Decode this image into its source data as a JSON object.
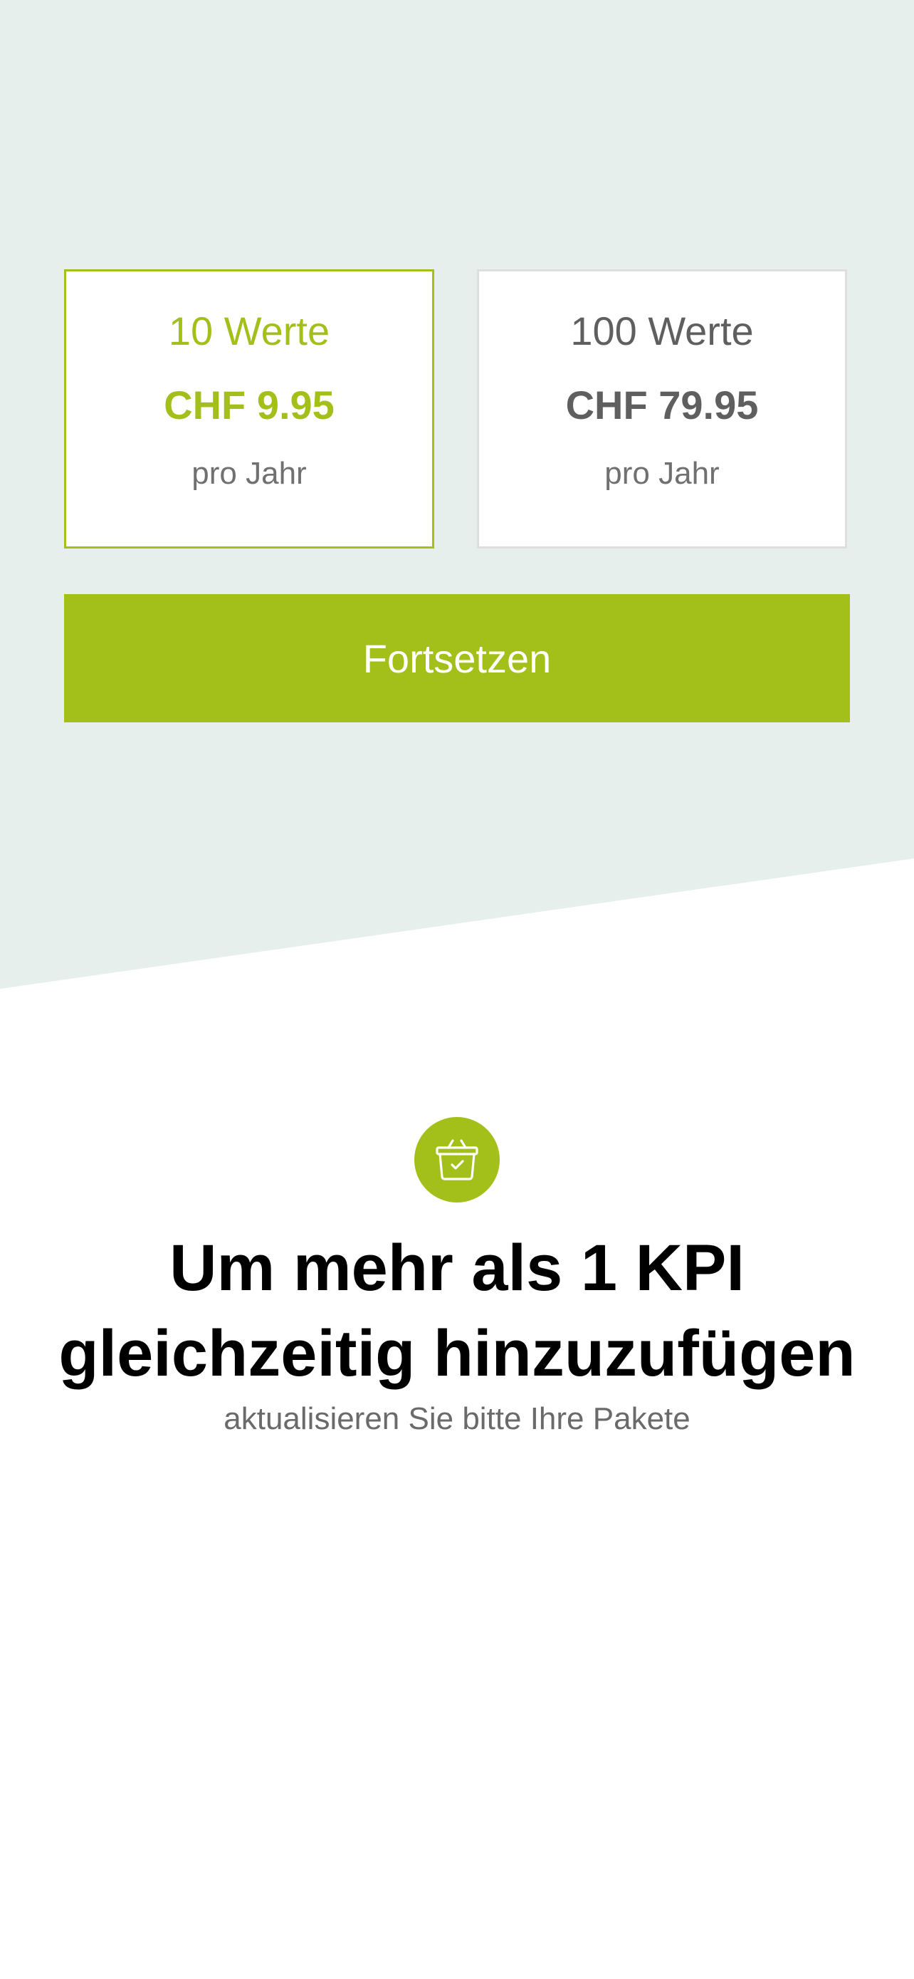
{
  "colors": {
    "accent": "#a3bf1a",
    "top_background": "#e6efec",
    "text_dark": "#000000",
    "text_muted": "#5f5f5f",
    "card_border": "#dddfde"
  },
  "plans": [
    {
      "name": "10 Werte",
      "price": "CHF 9.95",
      "period": "pro Jahr",
      "selected": true
    },
    {
      "name": "100 Werte",
      "price": "CHF 79.95",
      "period": "pro Jahr",
      "selected": false
    }
  ],
  "continue_button": {
    "label": "Fortsetzen"
  },
  "info": {
    "icon": "shopping-basket-check-icon",
    "headline_line1": "Um mehr als 1 KPI",
    "headline_line2": "gleichzeitig hinzuzufügen",
    "subline": "aktualisieren Sie bitte Ihre Pakete"
  }
}
